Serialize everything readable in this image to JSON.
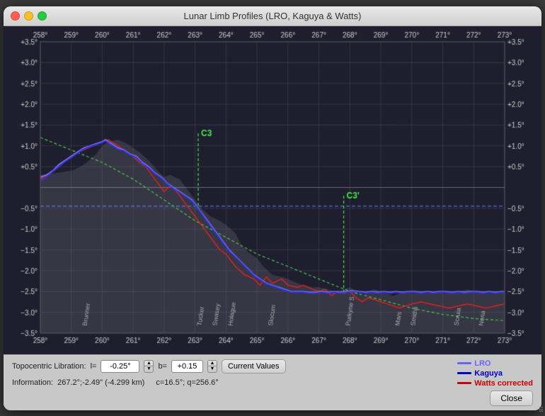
{
  "window": {
    "title": "Lunar Limb Profiles (LRO, Kaguya & Watts)"
  },
  "traffic_lights": {
    "close": "close",
    "minimize": "minimize",
    "maximize": "maximize"
  },
  "chart": {
    "x_min": 258,
    "x_max": 273,
    "y_min": -3.5,
    "y_max": 3.5,
    "x_labels": [
      "258°",
      "259°",
      "260°",
      "261°",
      "262°",
      "263°",
      "264°",
      "265°",
      "266°",
      "267°",
      "268°",
      "269°",
      "270°",
      "271°",
      "272°",
      "273°"
    ],
    "y_labels_left": [
      "+3.5°",
      "+3.0°",
      "+2.5°",
      "+2.0°",
      "+1.5°",
      "+1.0°",
      "+0.5°",
      "−0.5°",
      "−1.0°",
      "−1.5°",
      "−2.0°",
      "−2.5°",
      "−3.0°",
      "−3.5°"
    ],
    "y_labels_right": [
      "+3.5°",
      "+3.0°",
      "+2.5°",
      "+2.0°",
      "+1.5°",
      "+1.0°",
      "+0.5°",
      "−0.5°",
      "−1.0°",
      "−1.5°",
      "−2.0°",
      "−2.5°",
      "−3.0°",
      "−3.5°"
    ],
    "c3_label": "C3",
    "c3prime_label": "C3'",
    "crater_labels": [
      "Brunner",
      "Tucker",
      "Swasey",
      "Holague",
      "Slocum",
      "Purkyne S",
      "Mars",
      "Smithii",
      "Scruia",
      "Neria"
    ]
  },
  "controls": {
    "libration_label": "Topocentric Libration:",
    "l_label": "l=",
    "l_value": "-0.25°",
    "b_label": "b=",
    "b_value": "+0.15",
    "current_values_btn": "Current Values",
    "information_label": "Information:",
    "info_value": "267.2°;-2.49\" (-4.299 km)",
    "c_value": "c=16.5°; q=256.6°",
    "close_btn": "Close"
  },
  "legend": {
    "items": [
      {
        "label": "LRO",
        "color": "#6666ff"
      },
      {
        "label": "Kaguya",
        "color": "#0000cc"
      },
      {
        "label": "Watts corrected",
        "color": "#cc0000"
      }
    ]
  }
}
